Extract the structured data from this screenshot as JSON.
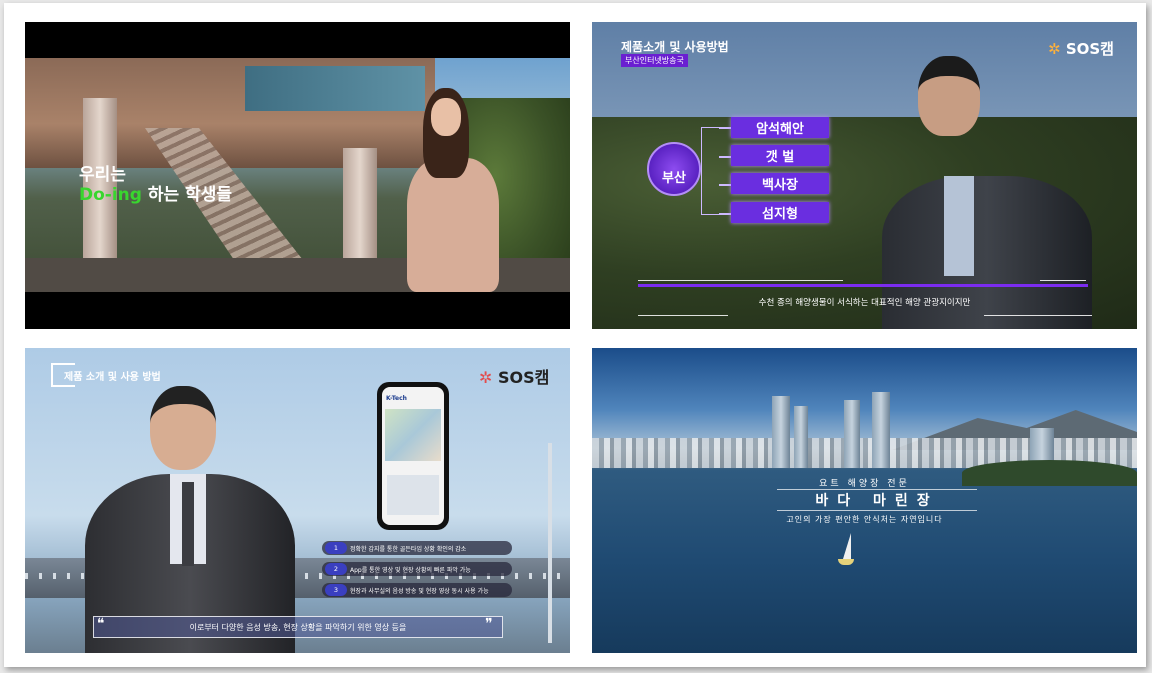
{
  "panel1": {
    "line1": "우리는",
    "line2_highlight": "Do-ing",
    "line2_rest": " 하는 학생들",
    "highlight_color": "#39d62f"
  },
  "panel2": {
    "title": "제품소개 및 사용방법",
    "subtitle": "부산인터넷방송국",
    "logo_text": "SOS캠",
    "badge": "부산",
    "tags": [
      "암석해안",
      "갯 벌",
      "백사장",
      "섬지형"
    ],
    "caption": "수천 종의 해양생물이 서식하는 대표적인 해양 관광지이지만",
    "accent_color": "#6a2ee0"
  },
  "panel3": {
    "title": "제품 소개 및 사용 방법",
    "logo_text": "SOS캠",
    "app_name": "K-Tech",
    "features": [
      {
        "num": "1",
        "text": "정확한 감지를 통한 골든타임 상황 확인의 감소"
      },
      {
        "num": "2",
        "text": "App를 통한 영상 및 현장 상황의 빠른 파악 가능"
      },
      {
        "num": "3",
        "text": "현장과 사무실의 음성 방송 및 현장 영상 동시 사용 가능"
      }
    ],
    "quote_open": "❝",
    "quote_close": "❞",
    "quote_text": "이로부터 다양한 음성 방송, 현장 상황을 파악하기 위한 영상 등을"
  },
  "panel4": {
    "small_title": "요트 해양장 전문",
    "main_title": "바다 마린장",
    "subtitle": "고인의 가장 편안한 안식처는 자연입니다"
  }
}
